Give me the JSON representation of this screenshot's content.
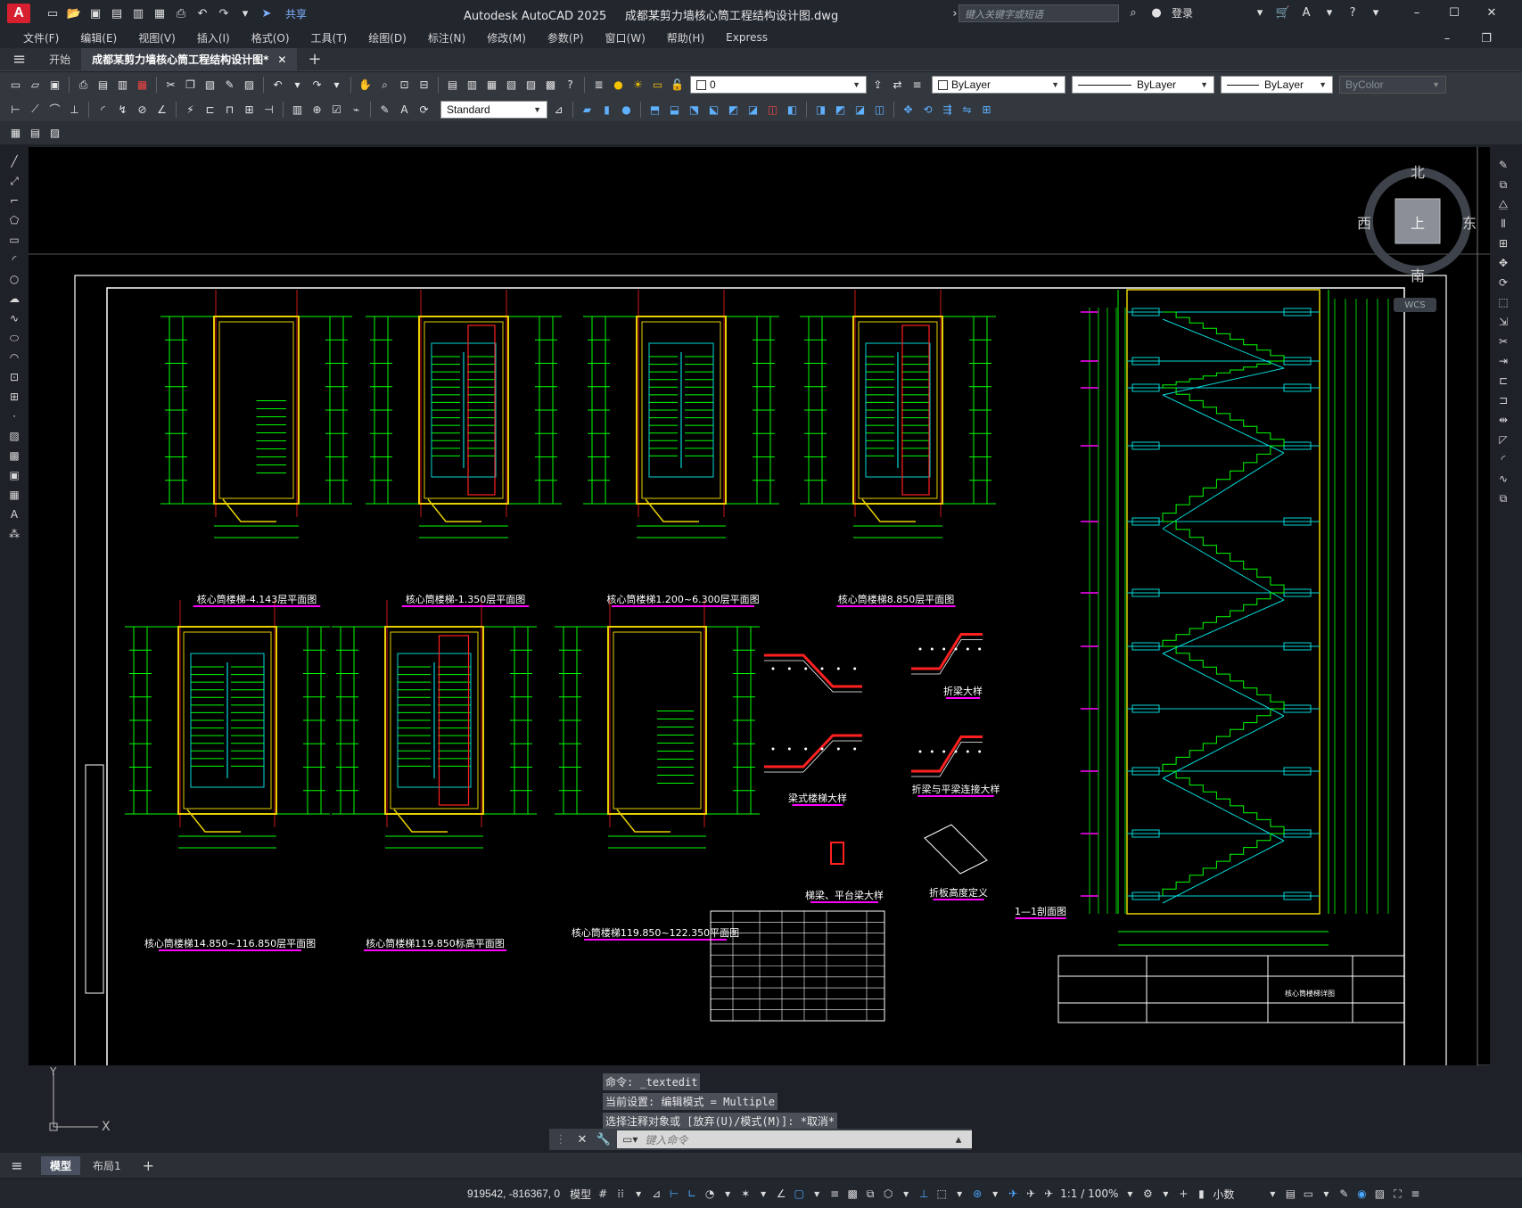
{
  "app": {
    "logo": "A",
    "title": "Autodesk AutoCAD 2025",
    "document": "成都某剪力墙核心筒工程结构设计图.dwg",
    "search_placeholder": "键入关键字或短语",
    "login": "登录",
    "share": "共享"
  },
  "menu": [
    "文件(F)",
    "编辑(E)",
    "视图(V)",
    "插入(I)",
    "格式(O)",
    "工具(T)",
    "绘图(D)",
    "标注(N)",
    "修改(M)",
    "参数(P)",
    "窗口(W)",
    "帮助(H)",
    "Express"
  ],
  "tabs": {
    "start": "开始",
    "drawing": "成都某剪力墙核心筒工程结构设计图*"
  },
  "properties": {
    "layer": "0",
    "color": "ByLayer",
    "linetype": "ByLayer",
    "lineweight": "ByLayer",
    "plotstyle": "ByColor",
    "textstyle": "Standard"
  },
  "viewcube": {
    "north": "北",
    "south": "南",
    "east": "东",
    "west": "西",
    "face": "上",
    "wcs": "WCS"
  },
  "drawing_titles": [
    "核心筒楼梯-4.143层平面图",
    "核心筒楼梯-1.350层平面图",
    "核心筒楼梯1.200~6.300层平面图",
    "核心筒楼梯8.850层平面图",
    "核心筒楼梯14.850~116.850层平面图",
    "核心筒楼梯119.850标高平面图",
    "核心筒楼梯119.850~122.350平面图",
    "梁式楼梯大样",
    "折梁大样",
    "折梁与平梁连接大样",
    "梯梁、平台梁大样",
    "折板高度定义",
    "1—1剖面图"
  ],
  "title_block": {
    "drawing_name": "核心筒楼梯详图"
  },
  "command": {
    "history": [
      "命令: _textedit",
      "当前设置: 编辑模式 = Multiple",
      "选择注释对象或 [放弃(U)/模式(M)]: *取消*"
    ],
    "placeholder": "键入命令"
  },
  "layout_tabs": [
    "模型",
    "布局1"
  ],
  "status": {
    "coords": "919542, -816367, 0",
    "space": "模型",
    "scale": "1:1 / 100%",
    "units": "小数"
  },
  "colors": {
    "accent": "#4aa8ff",
    "cad_green": "#00ff00",
    "cad_yellow": "#e6d000",
    "cad_cyan": "#00d8d8",
    "cad_red": "#ff2020",
    "cad_magenta": "#ff00ff"
  }
}
